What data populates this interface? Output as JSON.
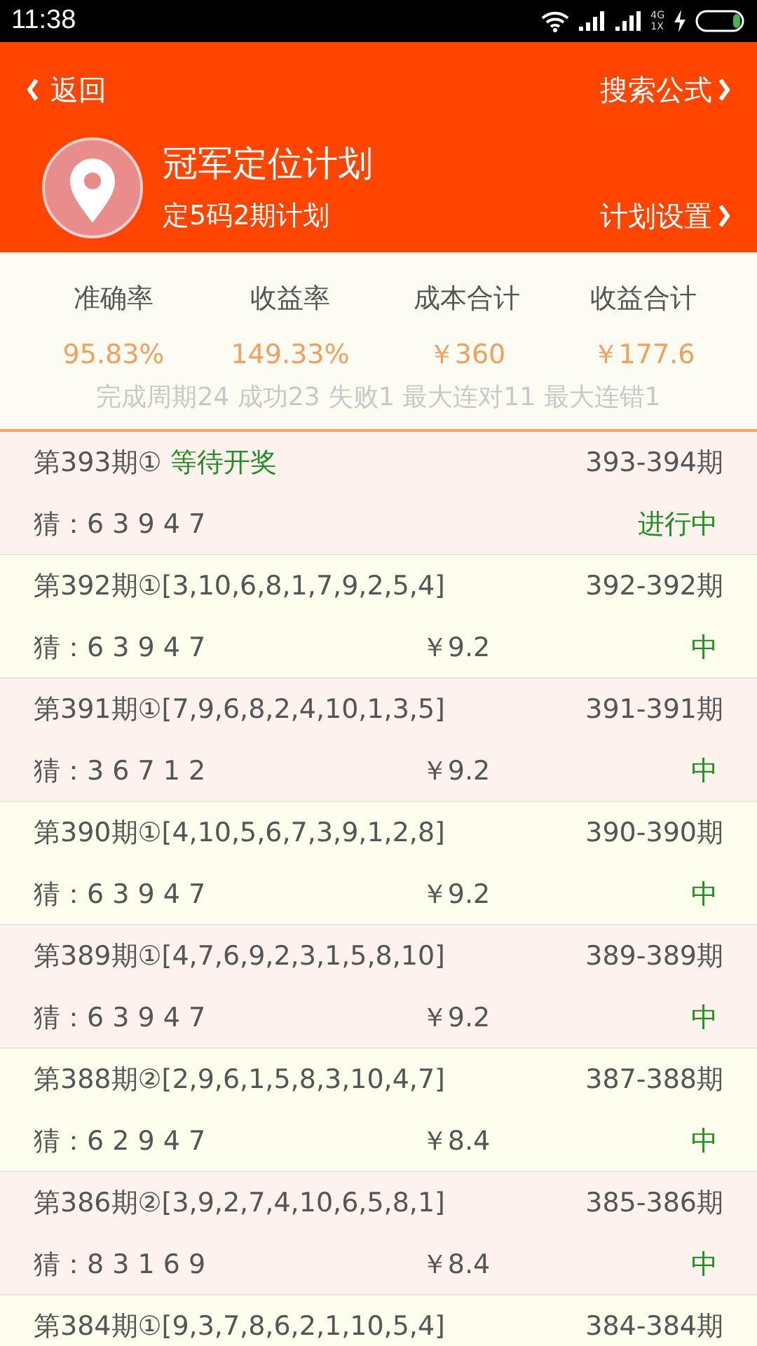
{
  "status_bar": {
    "time": "11:38",
    "network": "4G\n1X"
  },
  "header": {
    "back": "返回",
    "search": "搜索公式",
    "title": "冠军定位计划",
    "subtitle": "定5码2期计划",
    "settings": "计划设置"
  },
  "stats": [
    {
      "label": "准确率",
      "value": "95.83%"
    },
    {
      "label": "收益率",
      "value": "149.33%"
    },
    {
      "label": "成本合计",
      "value": "￥360"
    },
    {
      "label": "收益合计",
      "value": "￥177.6"
    }
  ],
  "summary": "完成周期24 成功23 失败1 最大连对11 最大连错1",
  "rows": [
    {
      "issue": "第393期①",
      "status": "等待开奖",
      "range": "393-394期",
      "guess": "猜：6 3 9 4 7",
      "result": "进行中"
    },
    {
      "issue": "第392期①",
      "draw": "[3,10,6,8,1,7,9,2,5,4]",
      "range": "392-392期",
      "guess": "猜：6 3 9 4 7",
      "amount": "￥9.2",
      "result": "中"
    },
    {
      "issue": "第391期①",
      "draw": "[7,9,6,8,2,4,10,1,3,5]",
      "range": "391-391期",
      "guess": "猜：3 6 7 1 2",
      "amount": "￥9.2",
      "result": "中"
    },
    {
      "issue": "第390期①",
      "draw": "[4,10,5,6,7,3,9,1,2,8]",
      "range": "390-390期",
      "guess": "猜：6 3 9 4 7",
      "amount": "￥9.2",
      "result": "中"
    },
    {
      "issue": "第389期①",
      "draw": "[4,7,6,9,2,3,1,5,8,10]",
      "range": "389-389期",
      "guess": "猜：6 3 9 4 7",
      "amount": "￥9.2",
      "result": "中"
    },
    {
      "issue": "第388期②",
      "draw": "[2,9,6,1,5,8,3,10,4,7]",
      "range": "387-388期",
      "guess": "猜：6 2 9 4 7",
      "amount": "￥8.4",
      "result": "中"
    },
    {
      "issue": "第386期②",
      "draw": "[3,9,2,7,4,10,6,5,8,1]",
      "range": "385-386期",
      "guess": "猜：8 3 1 6 9",
      "amount": "￥8.4",
      "result": "中"
    },
    {
      "issue": "第384期①",
      "draw": "[9,3,7,8,6,2,1,10,5,4]",
      "range": "384-384期"
    }
  ]
}
